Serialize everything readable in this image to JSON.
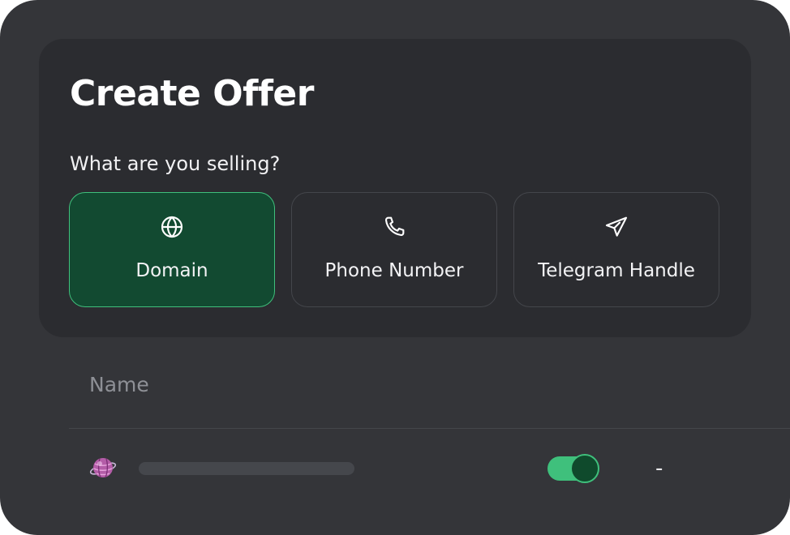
{
  "card": {
    "title": "Create Offer",
    "question": "What are you selling?",
    "options": [
      {
        "label": "Domain",
        "icon": "globe-icon",
        "selected": true
      },
      {
        "label": "Phone Number",
        "icon": "phone-icon",
        "selected": false
      },
      {
        "label": "Telegram Handle",
        "icon": "send-icon",
        "selected": false
      }
    ]
  },
  "table": {
    "columns": [
      "Name"
    ],
    "rows": [
      {
        "avatar": "planet-avatar-icon",
        "name": "",
        "toggle_on": true,
        "value": "-"
      }
    ]
  },
  "colors": {
    "background": "#343539",
    "card": "#2b2c30",
    "accent": "#3fc07c",
    "selected_fill": "#124a31"
  }
}
